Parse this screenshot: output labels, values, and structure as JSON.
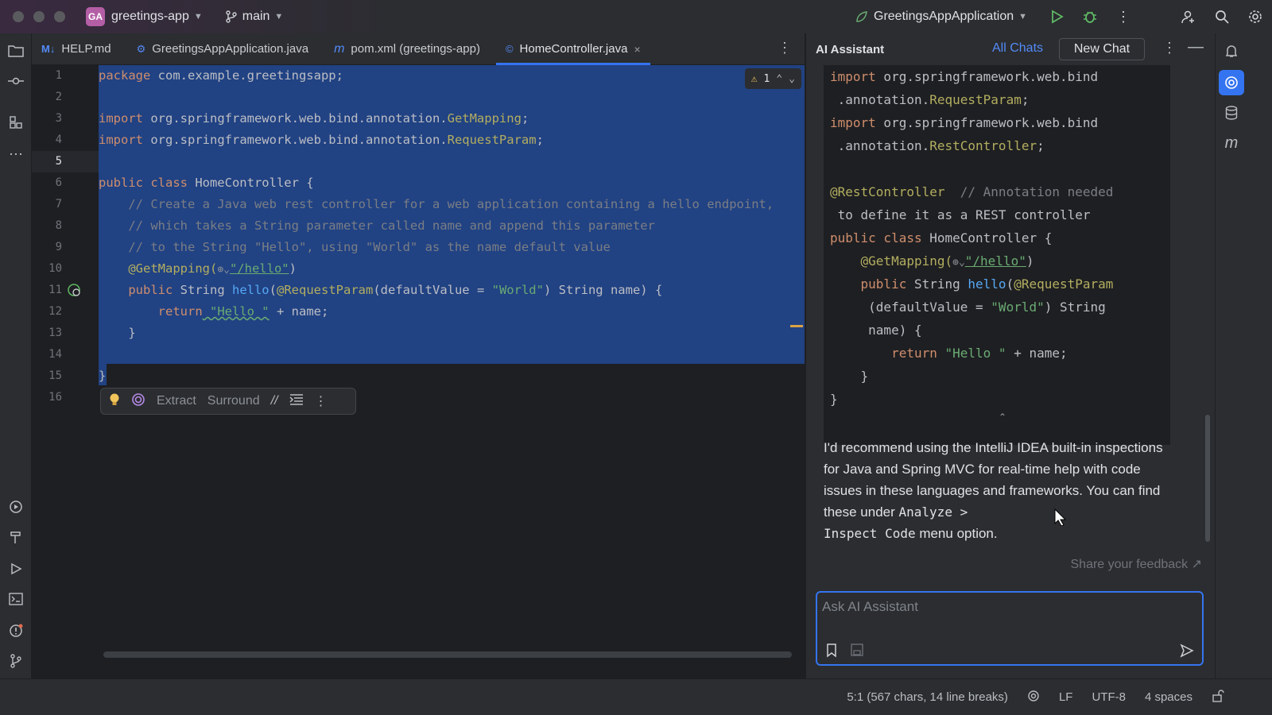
{
  "titlebar": {
    "project_badge": "GA",
    "project_name": "greetings-app",
    "branch": "main",
    "run_config": "GreetingsAppApplication"
  },
  "tabs": [
    {
      "icon": "M↓",
      "label": "HELP.md"
    },
    {
      "icon": "⚙",
      "label": "GreetingsAppApplication.java"
    },
    {
      "icon": "m",
      "label": "pom.xml (greetings-app)"
    },
    {
      "icon": "©",
      "label": "HomeController.java",
      "close": "×"
    }
  ],
  "editor": {
    "line_numbers": [
      "1",
      "2",
      "3",
      "4",
      "5",
      "6",
      "7",
      "8",
      "9",
      "10",
      "11",
      "12",
      "13",
      "14",
      "15",
      "16"
    ],
    "current_line": "5",
    "warning_count": "1",
    "lines": {
      "l1a": "package",
      "l1b": " com.example.greetingsapp;",
      "l3a": "import",
      "l3b": " org.springframework.web.bind.annotation.",
      "l3c": "GetMapping",
      "l3d": ";",
      "l4a": "import",
      "l4b": " org.springframework.web.bind.annotation.",
      "l4c": "RequestParam",
      "l4d": ";",
      "l6a": "public class",
      "l6b": " HomeController {",
      "l7": "    // Create a Java web rest controller for a web application containing a hello endpoint,",
      "l8": "    // which takes a String parameter called name and append this parameter",
      "l9": "    // to the String \"Hello\", using \"World\" as the name default value",
      "l10a": "    @GetMapping(",
      "l10b": "⊕⌄",
      "l10c": "\"/hello\"",
      "l10d": ")",
      "l11a": "    public",
      "l11b": " String ",
      "l11c": "hello",
      "l11d": "(",
      "l11e": "@RequestParam",
      "l11f": "(defaultValue = ",
      "l11g": "\"World\"",
      "l11h": ") String name) {",
      "l12a": "        return",
      "l12b": " \"Hello \"",
      "l12c": " + name;",
      "l13": "    }",
      "l15": "}"
    }
  },
  "floatbar": {
    "extract": "Extract",
    "surround": "Surround"
  },
  "ai": {
    "title": "AI Assistant",
    "all_chats": "All Chats",
    "new_chat": "New Chat",
    "code": {
      "c1a": "import",
      "c1b": " org.springframework.web.bind",
      "c2a": " .annotation.",
      "c2b": "RequestParam",
      "c2c": ";",
      "c3a": "import",
      "c3b": " org.springframework.web.bind",
      "c4a": " .annotation.",
      "c4b": "RestController",
      "c4c": ";",
      "c6a": "@RestController",
      "c6b": "  // Annotation needed",
      "c7": " to define it as a REST controller",
      "c8a": "public class",
      "c8b": " HomeController {",
      "c9a": "    @GetMapping(",
      "c9b": "⊕⌄",
      "c9c": "\"/hello\"",
      "c9d": ")",
      "c10a": "    public",
      "c10b": " String ",
      "c10c": "hello",
      "c10d": "(",
      "c10e": "@RequestParam",
      "c11a": "     (defaultValue = ",
      "c11b": "\"World\"",
      "c11c": ") String",
      "c12": "     name) {",
      "c13a": "        return",
      "c13b": " \"Hello \"",
      "c13c": " + name;",
      "c14": "    }",
      "c15": "}"
    },
    "message_part1": "I'd recommend using the IntelliJ IDEA built-in inspections for Java and Spring MVC for real-time help with code issues in these languages and frameworks. You can find these under ",
    "message_code1": "Analyze >",
    "message_code2": "Inspect Code",
    "message_part2": " menu option.",
    "feedback": "Share your feedback ↗",
    "input_placeholder": "Ask AI Assistant"
  },
  "statusbar": {
    "position": "5:1 (567 chars, 14 line breaks)",
    "line_sep": "LF",
    "encoding": "UTF-8",
    "indent": "4 spaces"
  },
  "colors": {
    "accent": "#3574f0",
    "selection": "#214283",
    "keyword": "#cf8e6d",
    "annotation": "#b3ae60",
    "string": "#6aab73",
    "function": "#56a8f5",
    "comment": "#7a7e85"
  }
}
